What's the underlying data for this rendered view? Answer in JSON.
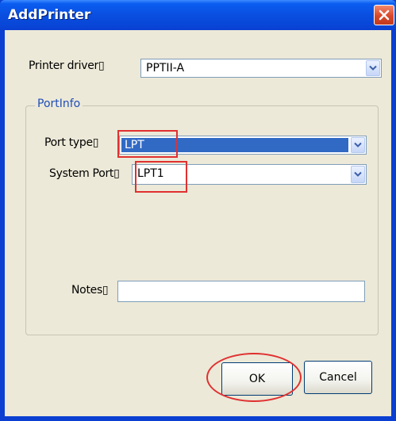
{
  "window": {
    "title": "AddPrinter",
    "close_icon": "close-icon",
    "accent_color": "#0a3fd1",
    "close_color": "#d8482a"
  },
  "form": {
    "printer_driver_label": "Printer driver▯",
    "printer_driver_value": "PPTII-A",
    "portinfo": {
      "title": "PortInfo",
      "port_type_label": "Port type▯",
      "port_type_value": "LPT",
      "system_port_label": "System Port▯",
      "system_port_value": "LPT1"
    },
    "notes_label": "Notes▯",
    "notes_value": ""
  },
  "buttons": {
    "ok_label": "OK",
    "cancel_label": "Cancel"
  },
  "annotations": {
    "highlight_color": "#e03030"
  }
}
